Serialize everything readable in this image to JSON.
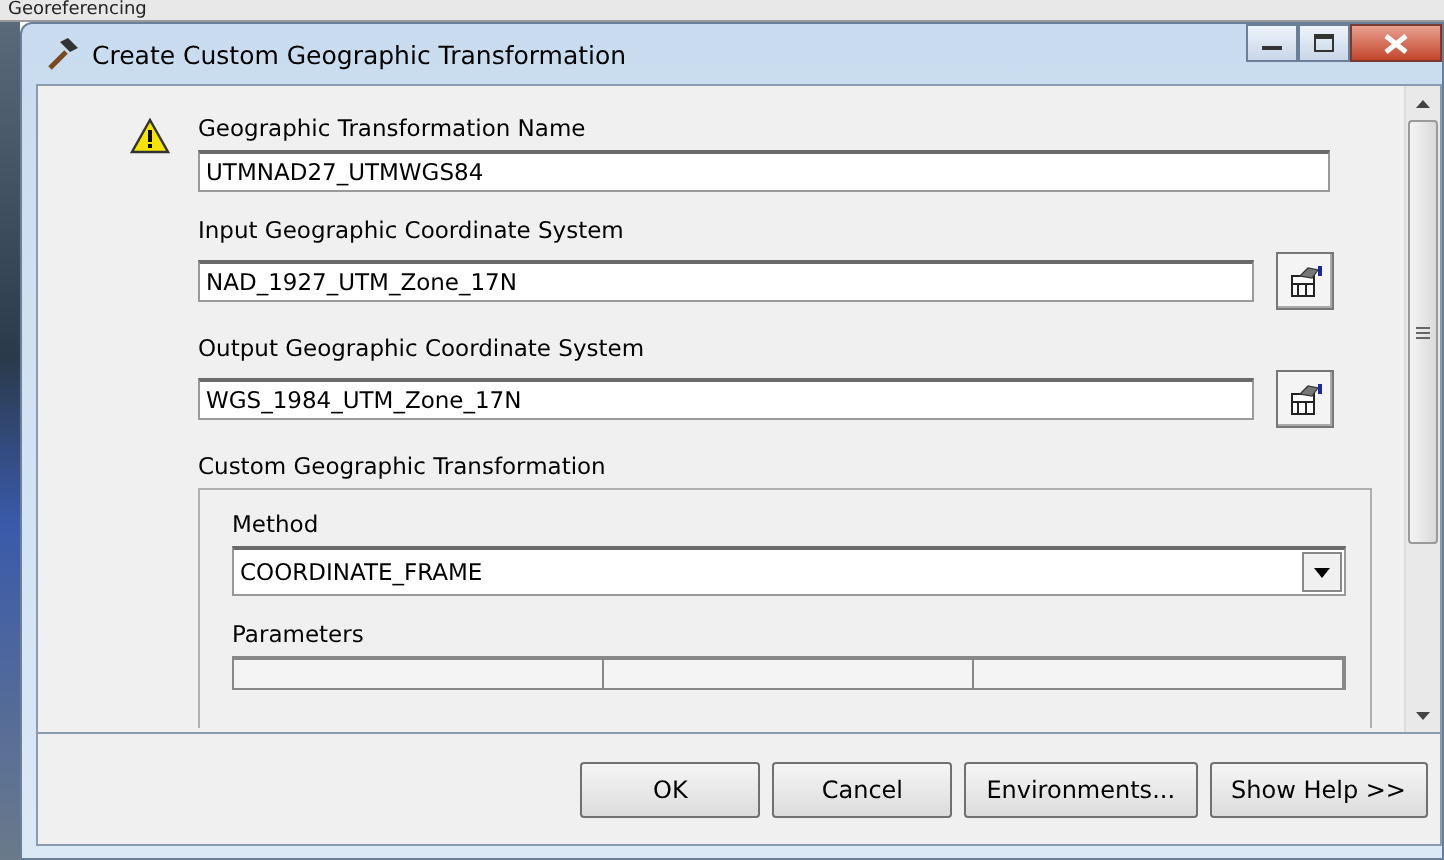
{
  "background": {
    "toolbar_label": "Georeferencing"
  },
  "window": {
    "title": "Create Custom Geographic Transformation"
  },
  "fields": [
    {
      "label": "Geographic Transformation Name",
      "value": "UTMNAD27_UTMWGS84",
      "warning": true,
      "browse": false
    },
    {
      "label": "Input Geographic Coordinate System",
      "value": "NAD_1927_UTM_Zone_17N",
      "warning": false,
      "browse": true
    },
    {
      "label": "Output Geographic Coordinate System",
      "value": "WGS_1984_UTM_Zone_17N",
      "warning": false,
      "browse": true
    }
  ],
  "custom_transformation": {
    "title": "Custom Geographic Transformation",
    "method_label": "Method",
    "method": "COORDINATE_FRAME",
    "parameters_label": "Parameters"
  },
  "buttons": [
    "OK",
    "Cancel",
    "Environments...",
    "Show Help >>"
  ]
}
